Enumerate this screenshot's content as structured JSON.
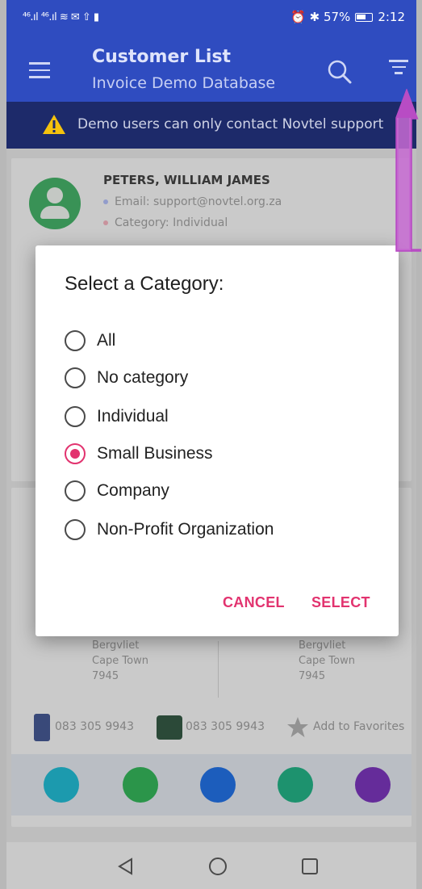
{
  "status_bar": {
    "left_icons": "⁴⁶.ıl ⁴⁶.ıl ≋ ✉ ⇧ ▮",
    "right_text": "⏰ ✱ 57%",
    "time": "2:12"
  },
  "app_bar": {
    "title": "Customer List",
    "subtitle": "Invoice Demo Database",
    "menu_icon": "hamburger-icon",
    "search_icon": "search-icon",
    "filter_icon": "filter-icon"
  },
  "banner": {
    "text": "Demo users can only contact Novtel support",
    "icon": "warning-icon",
    "icon_color": "#f4c20d"
  },
  "customers": [
    {
      "name": "PETERS, WILLIAM JAMES",
      "email": "Email: support@novtel.org.za",
      "category": "Category: Individual"
    }
  ],
  "card2": {
    "address_left": [
      "Bergvliet",
      "Cape Town",
      "7945"
    ],
    "address_right": [
      "Bergvliet",
      "Cape Town",
      "7945"
    ],
    "mobile": "083 305 9943",
    "landline": "083 305 9943",
    "favorites": "Add to Favorites"
  },
  "action_colors": [
    "#1ea3b8",
    "#2e9e4f",
    "#1e63c7",
    "#1f9a74",
    "#6b2fa3"
  ],
  "dialog": {
    "title": "Select a Category:",
    "options": [
      {
        "label": "All",
        "checked": false
      },
      {
        "label": "No category",
        "checked": false
      },
      {
        "label": "Individual",
        "checked": false
      },
      {
        "label": "Small Business",
        "checked": true
      },
      {
        "label": "Company",
        "checked": false
      },
      {
        "label": "Non-Profit Organization",
        "checked": false
      }
    ],
    "cancel_label": "CANCEL",
    "select_label": "SELECT",
    "accent_color": "#e2336f"
  },
  "nav_bar": {
    "back_icon": "back-triangle-icon",
    "home_icon": "home-circle-icon",
    "recents_icon": "recents-square-icon"
  },
  "colors": {
    "primary": "#2f4cc0",
    "banner_bg": "#1d2a6a",
    "annotation": "#b84cc4"
  }
}
